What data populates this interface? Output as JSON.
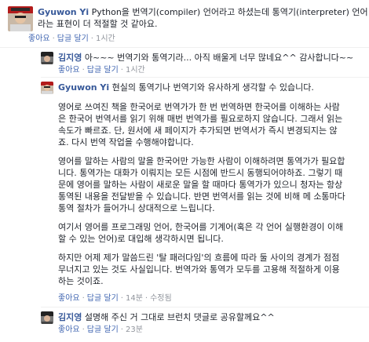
{
  "actions": {
    "like": "좋아요",
    "reply": "답글 달기",
    "edited": "수정됨"
  },
  "comments": [
    {
      "author": "Gyuwon Yi",
      "first_line": "Python을 번역기(compiler) 언어라고 하셨는데 통역기(interpreter) 언어",
      "lines": [
        "라는 표현이 더 적절할 것 같아요."
      ],
      "time": "1시간"
    },
    {
      "author": "김지영",
      "first_line": "아~~~ 번역기와 통역기라... 아직 배울게 너무 많네요^^ 감사합니다~~",
      "time": "1시간"
    },
    {
      "author": "Gyuwon Yi",
      "first_line": "현실의 통역기나 번역기와 유사하게 생각할 수 있습니다.",
      "paragraphs": [
        [
          "영어로 쓰여진 책을 한국어로 번역가가 한 번 번역하면 한국어를 이해하는 사람",
          "은 한국어 번역서를 읽기 위해 매번 번역가를 필요로하지 않습니다. 그래서 읽는",
          "속도가 빠르죠. 단, 원서에 새 페이지가 추가되면 번역서가 즉시 변경되지는 않",
          "죠. 다시 번역 작업을 수행해야합니다."
        ],
        [
          "영어를 말하는 사람의 말을 한국어만 가능한 사람이 이해하려면 통역가가 필요합",
          "니다. 통역가는 대화가 이뤄지는 모든 시점에 반드시 동행되어야하죠. 그렇기 때",
          "문에 영어를 말하는 사람이 새로운 말을 할 때마다 통역가가 있으니 청자는 항상",
          "통역된 내용을 전달받을 수 있습니다. 반면 번역서를 읽는 것에 비해 메 소통마다",
          "통역 절차가 들어가니 상대적으로 느립니다."
        ],
        [
          "여기서 영어를 프로그래밍 언어, 한국어를 기계어(혹은 각 언어 실행환경이 이해",
          "할 수 있는 언어)로 대입해 생각하시면 됩니다."
        ],
        [
          "하지만 어제 제가 말씀드린 '탈 패러다임'의 흐름에 따라 둘 사이의 경계가 점점",
          "무너지고 있는 것도 사실입니다. 번역가와 통역가 모두를 고용해 적절하게 이용",
          "하는 것이죠."
        ]
      ],
      "time": "14분"
    },
    {
      "author": "김지영",
      "first_line": "설명해 주신 거 그대로 브런치 댓글로 공유할께요^^",
      "time": "23분"
    }
  ],
  "colors": {
    "name": "#365899",
    "link": "#4267b2",
    "meta": "#90949c",
    "text": "#1d2129"
  }
}
